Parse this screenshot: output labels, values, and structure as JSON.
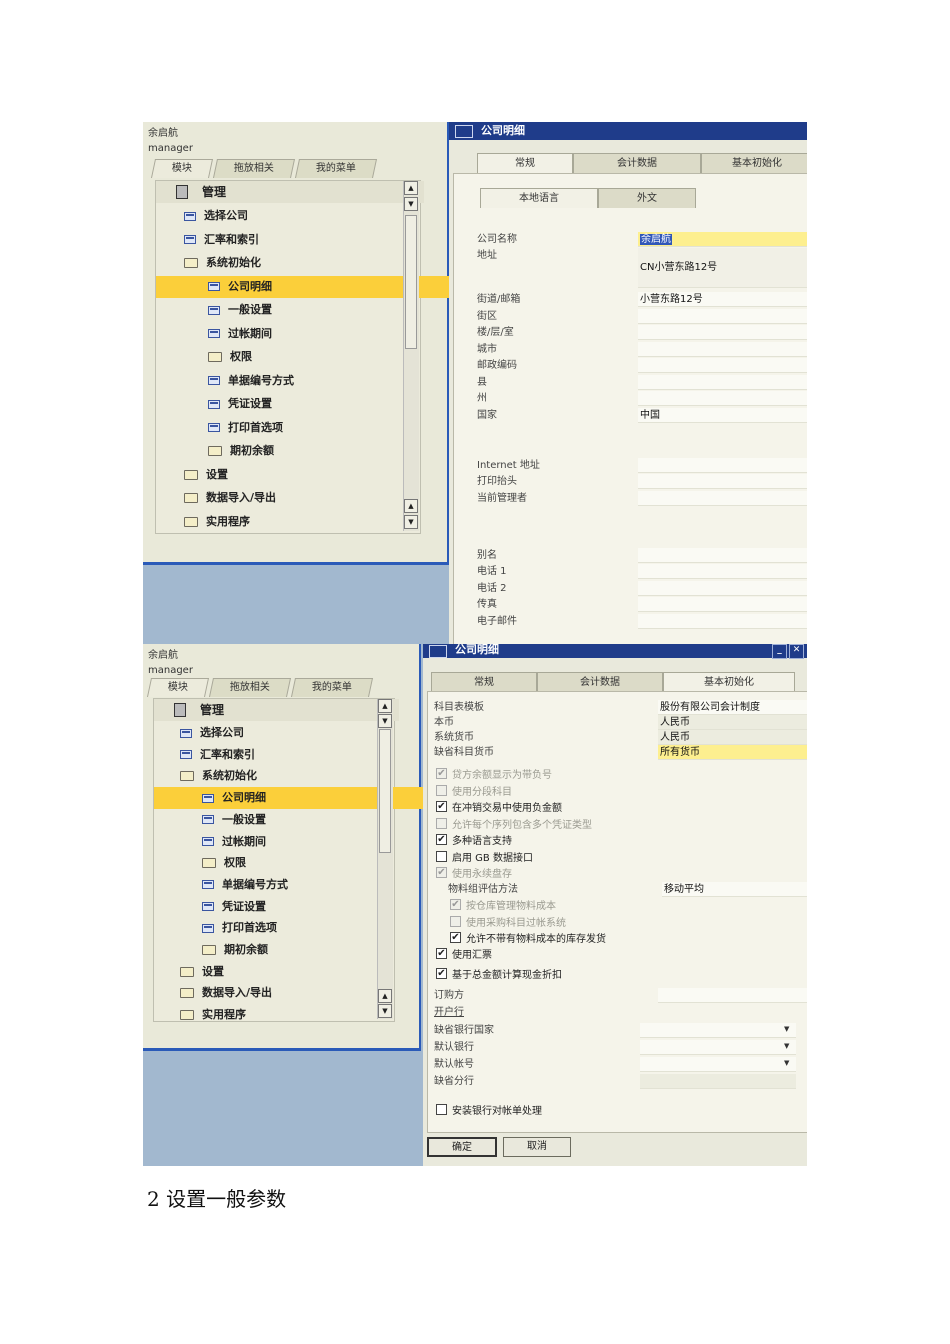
{
  "navigator": {
    "user_name": "余启航",
    "user_role": "manager",
    "tabs": [
      "模块",
      "拖放相关",
      "我的菜单"
    ],
    "tree_root": "管理",
    "tree_items": [
      {
        "label": "选择公司",
        "kind": "doc",
        "level": 1
      },
      {
        "label": "汇率和索引",
        "kind": "doc",
        "level": 1
      },
      {
        "label": "系统初始化",
        "kind": "folder-open",
        "level": 1
      },
      {
        "label": "公司明细",
        "kind": "doc",
        "level": 2,
        "selected": true
      },
      {
        "label": "一般设置",
        "kind": "doc",
        "level": 2
      },
      {
        "label": "过帐期间",
        "kind": "doc",
        "level": 2
      },
      {
        "label": "权限",
        "kind": "folder",
        "level": 2
      },
      {
        "label": "单据编号方式",
        "kind": "doc",
        "level": 2
      },
      {
        "label": "凭证设置",
        "kind": "doc",
        "level": 2
      },
      {
        "label": "打印首选项",
        "kind": "doc",
        "level": 2
      },
      {
        "label": "期初余额",
        "kind": "folder",
        "level": 2
      },
      {
        "label": "设置",
        "kind": "folder",
        "level": 1
      },
      {
        "label": "数据导入/导出",
        "kind": "folder",
        "level": 1
      },
      {
        "label": "实用程序",
        "kind": "folder",
        "level": 1
      }
    ]
  },
  "window": {
    "title": "公司明细",
    "main_tabs": [
      "常规",
      "会计数据",
      "基本初始化"
    ]
  },
  "general": {
    "sub_tabs": [
      "本地语言",
      "外文"
    ],
    "fields": [
      {
        "label": "公司名称",
        "value": "余启航"
      },
      {
        "label": "地址",
        "value": "CN小营东路12号"
      },
      {
        "label": "街道/邮箱",
        "value": "小营东路12号"
      },
      {
        "label": "街区",
        "value": ""
      },
      {
        "label": "楼/层/室",
        "value": ""
      },
      {
        "label": "城市",
        "value": ""
      },
      {
        "label": "邮政编码",
        "value": ""
      },
      {
        "label": "县",
        "value": ""
      },
      {
        "label": "州",
        "value": ""
      },
      {
        "label": "国家",
        "value": "中国"
      },
      {
        "label": "Internet 地址",
        "value": ""
      },
      {
        "label": "打印抬头",
        "value": ""
      },
      {
        "label": "当前管理者",
        "value": ""
      },
      {
        "label": "别名",
        "value": ""
      },
      {
        "label": "电话 1",
        "value": ""
      },
      {
        "label": "电话 2",
        "value": ""
      },
      {
        "label": "传真",
        "value": ""
      },
      {
        "label": "电子邮件",
        "value": ""
      }
    ]
  },
  "basic_init": {
    "fields": [
      {
        "label": "科目表模板",
        "value": "股份有限公司会计制度"
      },
      {
        "label": "本币",
        "value": "人民币"
      },
      {
        "label": "系统货币",
        "value": "人民币"
      },
      {
        "label": "缺省科目货币",
        "value": "所有货币"
      }
    ],
    "checkboxes": [
      {
        "label": "贷方余额显示为带负号",
        "checked": true,
        "disabled": true
      },
      {
        "label": "使用分段科目",
        "checked": false,
        "disabled": true
      },
      {
        "label": "在冲销交易中使用负金额",
        "checked": true,
        "disabled": false
      },
      {
        "label": "允许每个序列包含多个凭证类型",
        "checked": false,
        "disabled": true
      },
      {
        "label": "多种语言支持",
        "checked": true,
        "disabled": false
      },
      {
        "label": "启用 GB 数据接口",
        "checked": false,
        "disabled": false
      },
      {
        "label": "使用永续盘存",
        "checked": true,
        "disabled": true
      }
    ],
    "valuation_label": "物料组评估方法",
    "valuation_value": "移动平均",
    "sub_checkboxes": [
      {
        "label": "按仓库管理物料成本",
        "checked": true,
        "disabled": true
      },
      {
        "label": "使用采购科目过帐系统",
        "checked": false,
        "disabled": true
      },
      {
        "label": "允许不带有物料成本的库存发货",
        "checked": true,
        "disabled": false
      }
    ],
    "checkboxes2": [
      {
        "label": "使用汇票",
        "checked": true,
        "disabled": false
      },
      {
        "label": "基于总金额计算现金折扣",
        "checked": true,
        "disabled": false
      }
    ],
    "order_party_label": "订购方",
    "bank_link_label": "开户行",
    "bank_fields": [
      {
        "label": "缺省银行国家",
        "value": "",
        "dropdown": true
      },
      {
        "label": "默认银行",
        "value": "",
        "dropdown": true
      },
      {
        "label": "默认帐号",
        "value": "",
        "dropdown": true
      },
      {
        "label": "缺省分行",
        "value": "",
        "dropdown": false
      }
    ],
    "install_bank": {
      "label": "安装银行对帐单处理",
      "checked": false
    },
    "ok_label": "确定",
    "cancel_label": "取消"
  },
  "caption": "2 设置一般参数"
}
